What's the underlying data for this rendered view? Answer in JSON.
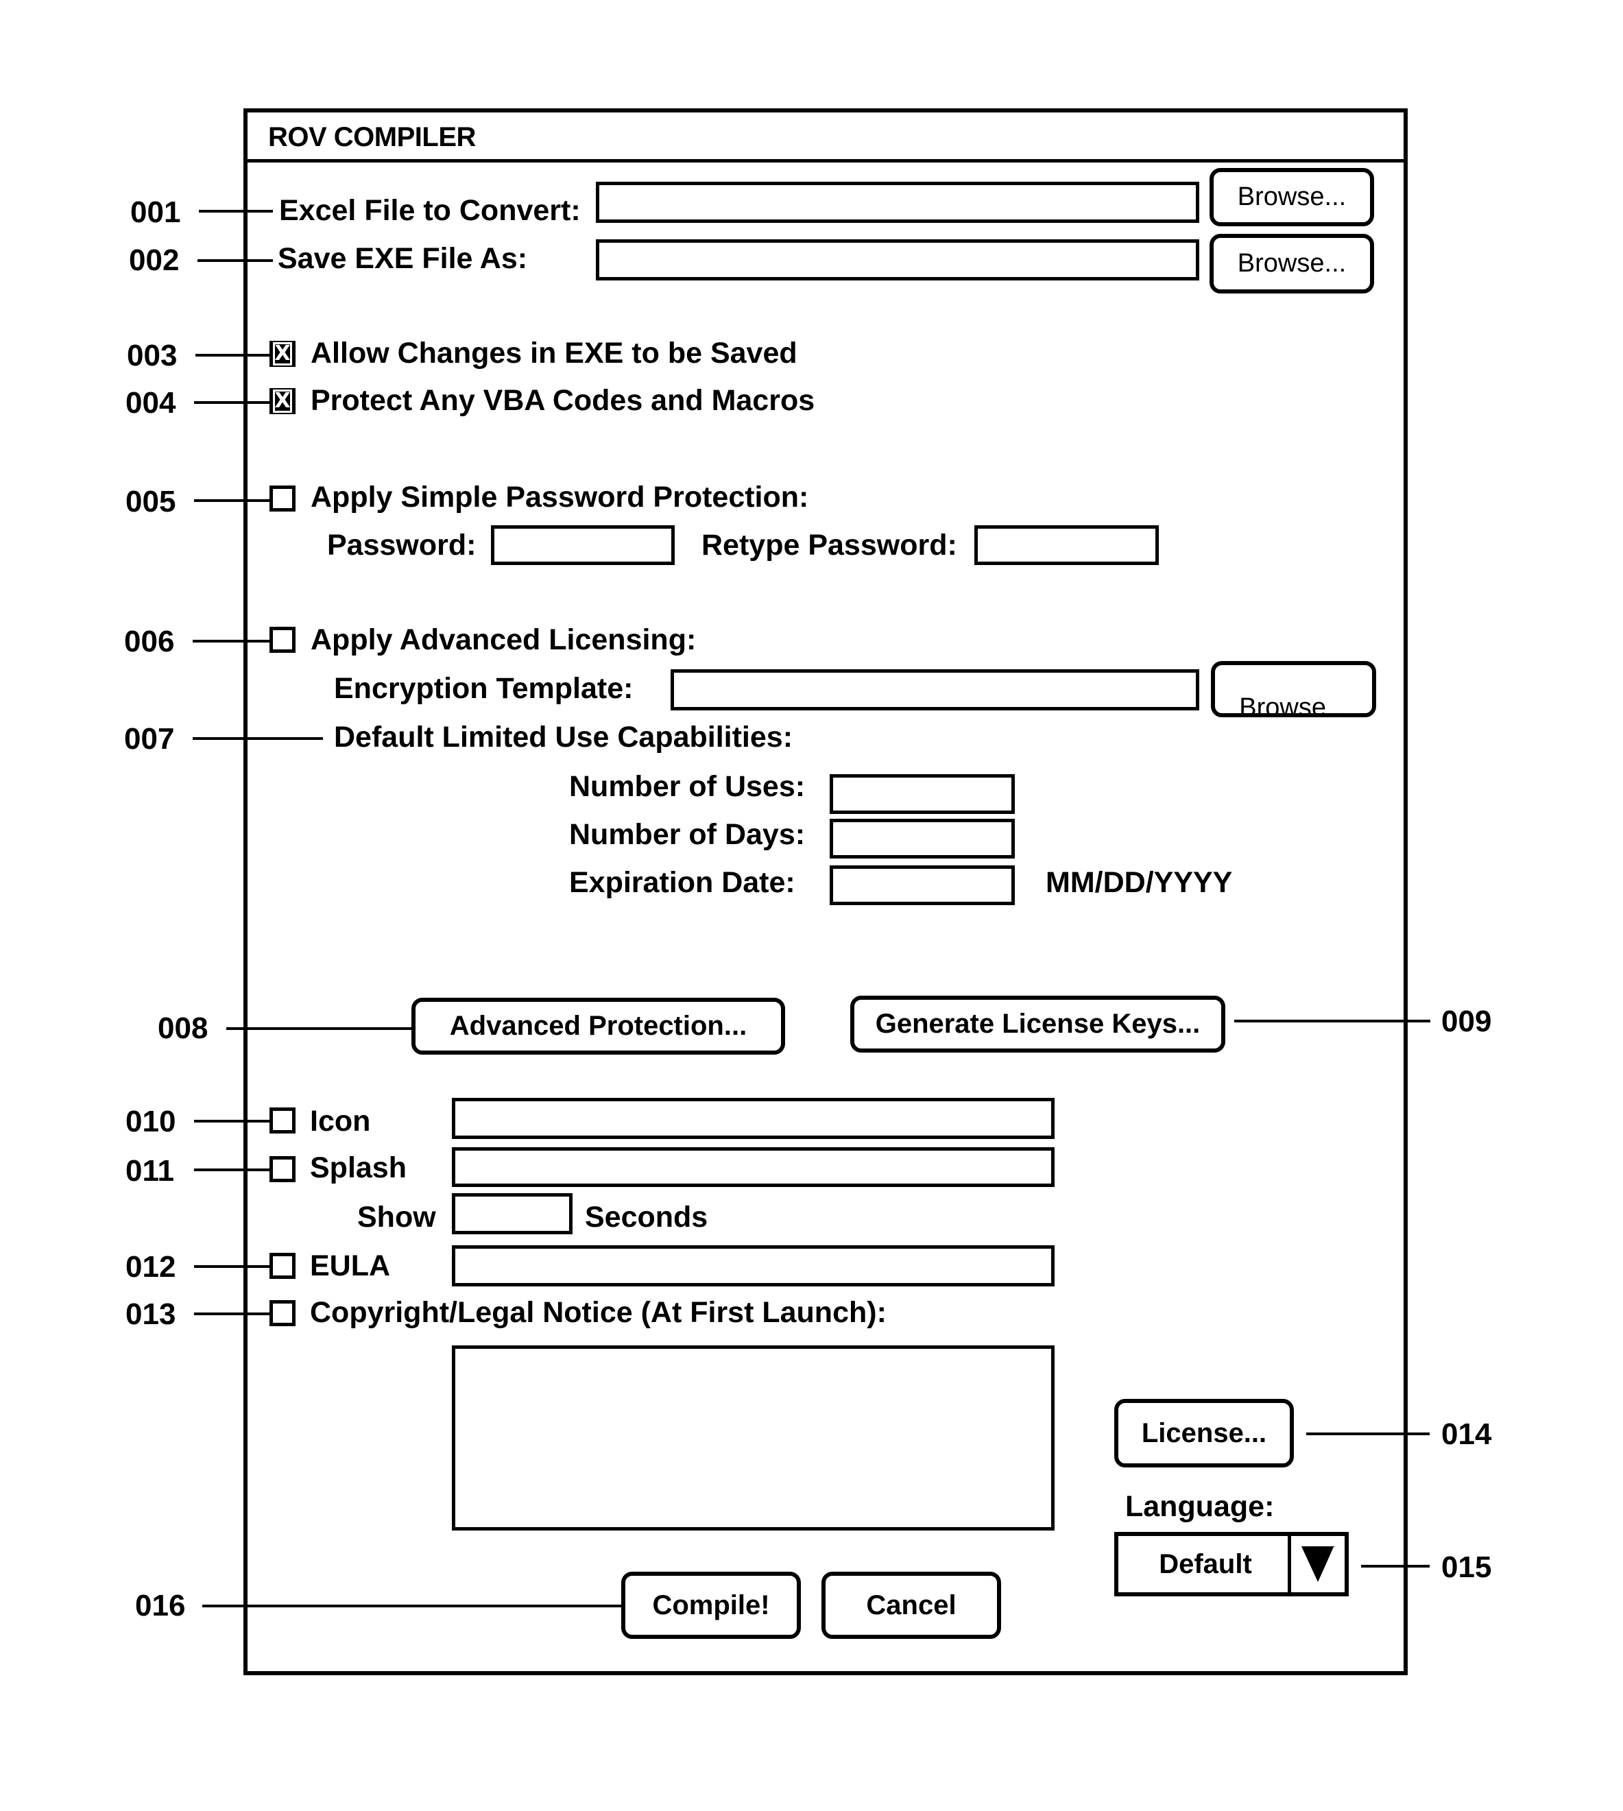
{
  "window": {
    "title": "ROV COMPILER"
  },
  "callouts": {
    "c001": "001",
    "c002": "002",
    "c003": "003",
    "c004": "004",
    "c005": "005",
    "c006": "006",
    "c007": "007",
    "c008": "008",
    "c009": "009",
    "c010": "010",
    "c011": "011",
    "c012": "012",
    "c013": "013",
    "c014": "014",
    "c015": "015",
    "c016": "016"
  },
  "files": {
    "excel_label": "Excel File to Convert:",
    "excel_value": "",
    "exe_label": "Save EXE File As:",
    "exe_value": "",
    "browse_label": "Browse..."
  },
  "options": {
    "allow_changes": {
      "label": "Allow Changes in EXE to be Saved",
      "checked": true,
      "mark": "X"
    },
    "protect_vba": {
      "label": "Protect Any VBA Codes and Macros",
      "checked": true,
      "mark": "X"
    }
  },
  "password": {
    "enable_label": "Apply Simple Password Protection:",
    "checked": false,
    "password_label": "Password:",
    "password_value": "",
    "retype_label": "Retype Password:",
    "retype_value": ""
  },
  "licensing": {
    "enable_label": "Apply Advanced Licensing:",
    "checked": false,
    "template_label": "Encryption Template:",
    "template_value": "",
    "browse_label": "Browse...",
    "limited_use_label": "Default Limited Use Capabilities:",
    "uses_label": "Number of Uses:",
    "uses_value": "",
    "days_label": "Number of Days:",
    "days_value": "",
    "expiration_label": "Expiration Date:",
    "expiration_value": "",
    "date_format": "MM/DD/YYYY"
  },
  "actions": {
    "advanced_protection": "Advanced Protection...",
    "generate_keys": "Generate License Keys...",
    "license": "License...",
    "compile": "Compile!",
    "cancel": "Cancel"
  },
  "branding": {
    "icon_label": "Icon",
    "icon_checked": false,
    "icon_value": "",
    "splash_label": "Splash",
    "splash_checked": false,
    "splash_value": "",
    "show_label": "Show",
    "seconds_value": "",
    "seconds_label": "Seconds",
    "eula_label": "EULA",
    "eula_checked": false,
    "eula_value": "",
    "notice_label": "Copyright/Legal Notice (At First Launch):",
    "notice_checked": false,
    "notice_value": ""
  },
  "language": {
    "label": "Language:",
    "selected": "Default"
  }
}
